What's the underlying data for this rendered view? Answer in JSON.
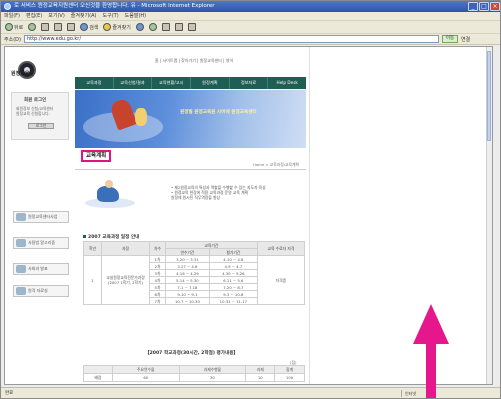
{
  "window": {
    "title": "로 서비스 원정교육지원센터 오신것을 환영합니다. 유 - Microsoft Internet Explorer",
    "controls": [
      "_",
      "□",
      "×"
    ]
  },
  "menubar": [
    "파일(F)",
    "편집(E)",
    "보기(V)",
    "즐겨찾기(A)",
    "도구(T)",
    "도움말(H)"
  ],
  "toolbar": {
    "back": "뒤로",
    "search": "검색",
    "favorites": "즐겨찾기"
  },
  "addressbar": {
    "label": "주소(D)",
    "url": "http://www.edu.go.kr/",
    "go": "이동",
    "links": "연결"
  },
  "site": {
    "logo_text": "원정교육원",
    "top_links": "홈  |  사이트맵  |  찾아가기  |  원정교육센터  |  영어",
    "nav": [
      "교육과정",
      "교육신청/결과",
      "교육현황/고시",
      "원정계획",
      "정보자료",
      "Help Desk"
    ],
    "login": {
      "title": "회원 로그인",
      "lines": [
        "회원정보 신청/교육센터",
        "원정교육 신청합니다."
      ],
      "button": "로그인"
    },
    "banner_text": "원정발 원정교육원 사이에 원정교육센터",
    "side_items": [
      "원정교육센터사업",
      "사용법 알고리즘",
      "사회과 발표",
      "원격 자료실"
    ],
    "page_heading": "교육계획",
    "breadcrumb": "Home > 교육과정/교육계획",
    "info_lines": [
      "• 제2원정교육의 특성과 역할을 수행할 수 있는 지도자 육성",
      "• 원정교육 현장에 적용 교육과정 운영 교육 계획",
      "   원정에 원시된 직무역량을 향상"
    ],
    "section_title": "2007 교육과정 일정 안내",
    "sub_title": "【2007 학교과정(30시간, 2학점) 평가내용】",
    "sub_note": "(점)"
  },
  "schedule": {
    "headers": [
      "학년",
      "과정",
      "차수",
      "교육기간",
      "",
      "교육 수료자 자격"
    ],
    "subheaders": [
      "연수기간",
      "평가기간"
    ],
    "course": "교실원정교육전문가과정 (2007 1학기, 2학기)",
    "eligibility": "자격증",
    "grade": "1",
    "rows": [
      [
        "1차",
        "3.20 ~ 3.31",
        "4.10 ~ 4.8"
      ],
      [
        "2차",
        "3.27 ~ 4.6",
        "4.9 ~ 4.7"
      ],
      [
        "3차",
        "4.16 ~ 4.29",
        "4.30 ~ 5.26"
      ],
      [
        "4차",
        "5.14 ~ 5.30",
        "6.11 ~ 5.6"
      ],
      [
        "5차",
        "7.1 ~ 7.18",
        "7.20 ~ 8.7"
      ],
      [
        "6차",
        "9.10 ~ 9.1",
        "9.3 ~ 10.8"
      ],
      [
        "7차",
        "10.7 ~ 10.30",
        "10.31 ~ 11.17"
      ]
    ]
  },
  "evaluation": {
    "headers": [
      "",
      "주요연수물",
      "과제수행물",
      "과제",
      "합계"
    ],
    "row": [
      "배점",
      "60",
      "30",
      "10",
      "100"
    ]
  },
  "statusbar": {
    "text": "완료",
    "zone": "인터넷"
  },
  "colors": {
    "nav_bg": "#1f5e55",
    "heading_border": "#e0147d",
    "arrow": "#e6168c",
    "titlebar": "#2c54a8"
  }
}
